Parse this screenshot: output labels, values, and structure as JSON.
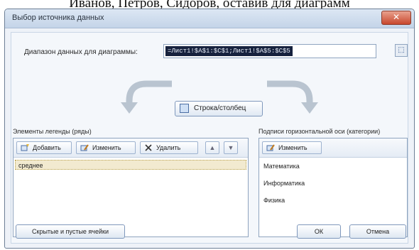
{
  "caption_above": "Иванов, Петров, Сидоров, оставив для диаграмм",
  "window": {
    "title": "Выбор источника данных",
    "close_label": "✕"
  },
  "range": {
    "label": "Диапазон данных для диаграммы:",
    "value": "=Лист1!$A$1:$C$1;Лист1!$A$5:$C$5",
    "collapse_icon": "range-collapse-icon"
  },
  "switch_button": {
    "label": "Строка/столбец",
    "icon": "switch-row-column-icon"
  },
  "legend": {
    "label": "Элементы легенды (ряды)",
    "buttons": {
      "add": "Добавить",
      "edit": "Изменить",
      "delete": "Удалить",
      "up": "▲",
      "down": "▼"
    },
    "items": [
      "среднее"
    ]
  },
  "axis": {
    "label": "Подписи горизонтальной оси (категории)",
    "edit_button": "Изменить",
    "items": [
      "Математика",
      "Информатика",
      "Физика"
    ]
  },
  "footer": {
    "hidden_cells_button": "Скрытые и пустые ячейки",
    "ok_button": "ОК",
    "cancel_button": "Отмена"
  },
  "colors": {
    "accent": "#7f98bc",
    "selected_row": "#f2ead0",
    "close_button": "#c8482e"
  }
}
